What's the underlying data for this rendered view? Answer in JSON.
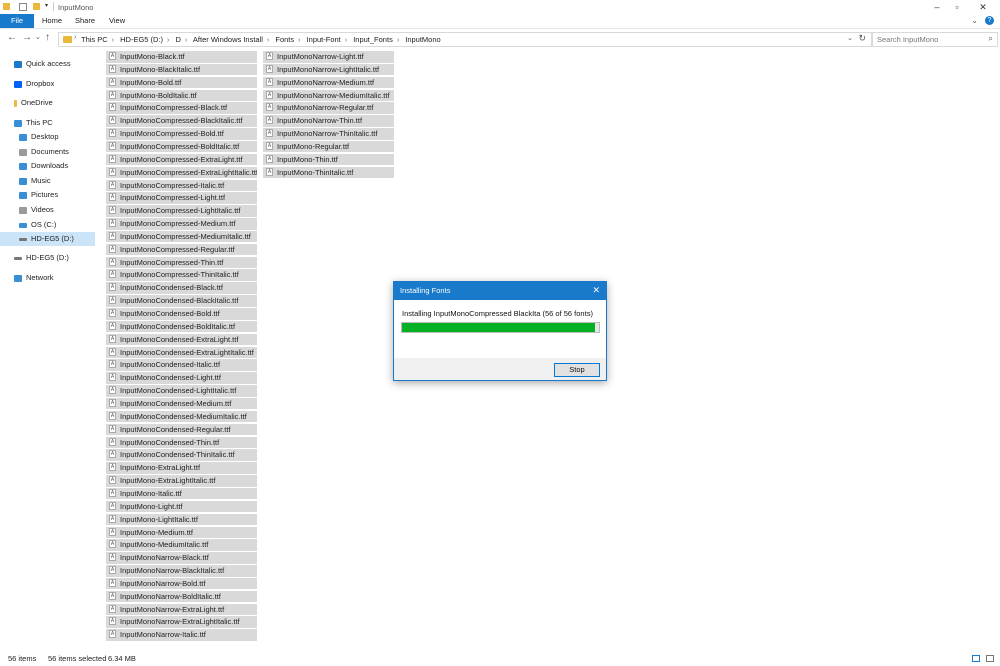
{
  "window": {
    "title": "InputMono"
  },
  "ribbon": {
    "tabs": [
      "File",
      "Home",
      "Share",
      "View"
    ]
  },
  "address": {
    "crumbs": [
      "This PC",
      "HD-EG5 (D:)",
      "D",
      "After Windows Install",
      "Fonts",
      "Input-Font",
      "Input_Fonts",
      "InputMono"
    ],
    "search_placeholder": "Search InputMono"
  },
  "nav": {
    "items": [
      {
        "label": "Quick access",
        "icon": "star-icon",
        "color": "#1979ca"
      },
      {
        "label": "Dropbox",
        "icon": "dropbox-icon",
        "color": "#0061ff"
      },
      {
        "label": "OneDrive",
        "icon": "onedrive-icon",
        "color": "#e8b93b"
      },
      {
        "label": "This PC",
        "icon": "computer-icon",
        "color": "#3a8ed6"
      },
      {
        "label": "Desktop",
        "icon": "desktop-icon",
        "color": "#3a8ed6"
      },
      {
        "label": "Documents",
        "icon": "documents-icon",
        "color": "#9a9a9a"
      },
      {
        "label": "Downloads",
        "icon": "downloads-icon",
        "color": "#3a8ed6"
      },
      {
        "label": "Music",
        "icon": "music-icon",
        "color": "#3a8ed6"
      },
      {
        "label": "Pictures",
        "icon": "pictures-icon",
        "color": "#3a8ed6"
      },
      {
        "label": "Videos",
        "icon": "videos-icon",
        "color": "#9a9a9a"
      },
      {
        "label": "OS (C:)",
        "icon": "drive-icon",
        "color": "#3a8ed6"
      },
      {
        "label": "HD-EG5 (D:)",
        "icon": "drive-icon",
        "color": "#777777"
      },
      {
        "label": "HD-EG5 (D:)",
        "icon": "drive-icon",
        "color": "#777777"
      },
      {
        "label": "Network",
        "icon": "network-icon",
        "color": "#3a8ed6"
      }
    ]
  },
  "files": [
    "InputMono-Black.ttf",
    "InputMono-BlackItalic.ttf",
    "InputMono-Bold.ttf",
    "InputMono-BoldItalic.ttf",
    "InputMonoCompressed-Black.ttf",
    "InputMonoCompressed-BlackItalic.ttf",
    "InputMonoCompressed-Bold.ttf",
    "InputMonoCompressed-BoldItalic.ttf",
    "InputMonoCompressed-ExtraLight.ttf",
    "InputMonoCompressed-ExtraLightItalic.ttf",
    "InputMonoCompressed-Italic.ttf",
    "InputMonoCompressed-Light.ttf",
    "InputMonoCompressed-LightItalic.ttf",
    "InputMonoCompressed-Medium.ttf",
    "InputMonoCompressed-MediumItalic.ttf",
    "InputMonoCompressed-Regular.ttf",
    "InputMonoCompressed-Thin.ttf",
    "InputMonoCompressed-ThinItalic.ttf",
    "InputMonoCondensed-Black.ttf",
    "InputMonoCondensed-BlackItalic.ttf",
    "InputMonoCondensed-Bold.ttf",
    "InputMonoCondensed-BoldItalic.ttf",
    "InputMonoCondensed-ExtraLight.ttf",
    "InputMonoCondensed-ExtraLightItalic.ttf",
    "InputMonoCondensed-Italic.ttf",
    "InputMonoCondensed-Light.ttf",
    "InputMonoCondensed-LightItalic.ttf",
    "InputMonoCondensed-Medium.ttf",
    "InputMonoCondensed-MediumItalic.ttf",
    "InputMonoCondensed-Regular.ttf",
    "InputMonoCondensed-Thin.ttf",
    "InputMonoCondensed-ThinItalic.ttf",
    "InputMono-ExtraLight.ttf",
    "InputMono-ExtraLightItalic.ttf",
    "InputMono-Italic.ttf",
    "InputMono-Light.ttf",
    "InputMono-LightItalic.ttf",
    "InputMono-Medium.ttf",
    "InputMono-MediumItalic.ttf",
    "InputMonoNarrow-Black.ttf",
    "InputMonoNarrow-BlackItalic.ttf",
    "InputMonoNarrow-Bold.ttf",
    "InputMonoNarrow-BoldItalic.ttf",
    "InputMonoNarrow-ExtraLight.ttf",
    "InputMonoNarrow-ExtraLightItalic.ttf",
    "InputMonoNarrow-Italic.ttf",
    "InputMonoNarrow-Light.ttf",
    "InputMonoNarrow-LightItalic.ttf",
    "InputMonoNarrow-Medium.ttf",
    "InputMonoNarrow-MediumItalic.ttf",
    "InputMonoNarrow-Regular.ttf",
    "InputMonoNarrow-Thin.ttf",
    "InputMonoNarrow-ThinItalic.ttf",
    "InputMono-Regular.ttf",
    "InputMono-Thin.ttf",
    "InputMono-ThinItalic.ttf"
  ],
  "status": {
    "count": "56 items",
    "selected": "56 items selected",
    "size": "6.34 MB"
  },
  "dialog": {
    "title": "Installing Fonts",
    "message": "Installing InputMonoCompressed BlackIta (56 of 56 fonts)",
    "progress": 0.98,
    "stop_label": "Stop"
  },
  "colors": {
    "accent": "#1979ca",
    "progress": "#06b025",
    "selection": "#d9d9d9"
  }
}
